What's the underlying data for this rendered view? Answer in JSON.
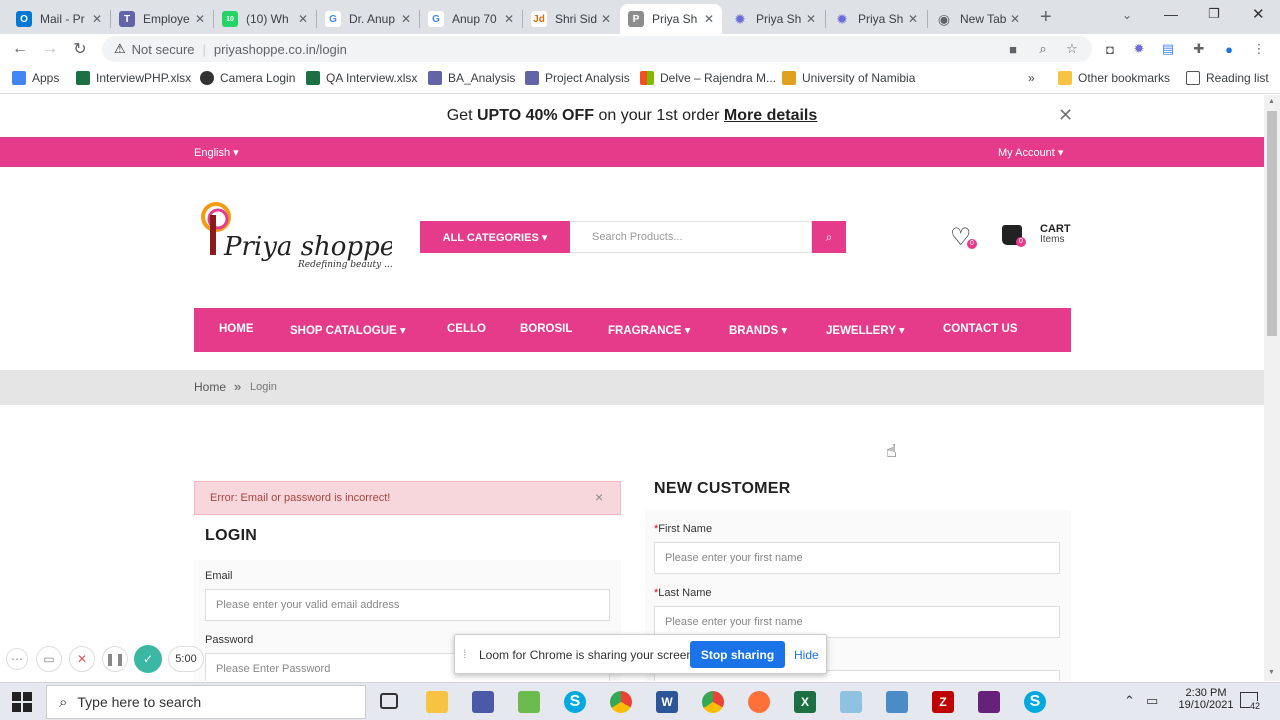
{
  "tabs": [
    {
      "title": "Mail - Pr",
      "fav": "outlook-icon",
      "color": "#0078d4",
      "glyph": "O"
    },
    {
      "title": "Employe",
      "fav": "teams-icon",
      "color": "#6264a7",
      "glyph": "T"
    },
    {
      "title": "(10) Wh",
      "fav": "whatsapp-icon",
      "color": "#25d366",
      "glyph": "10"
    },
    {
      "title": "Dr. Anup",
      "fav": "google-icon",
      "color": "#ffffff",
      "glyph": "G"
    },
    {
      "title": "Anup 70",
      "fav": "google-icon",
      "color": "#ffffff",
      "glyph": "G"
    },
    {
      "title": "Shri Sidd",
      "fav": "justdial-icon",
      "color": "#ffffff",
      "glyph": "Jd"
    },
    {
      "title": "Priya Sh",
      "fav": "priya-icon",
      "color": "#8d8d8d",
      "glyph": "P"
    },
    {
      "title": "Priya Sh",
      "fav": "gear-icon",
      "color": "#6c6cd8",
      "glyph": "✹"
    },
    {
      "title": "Priya Sh",
      "fav": "gear-icon",
      "color": "#6c6cd8",
      "glyph": "✹"
    },
    {
      "title": "New Tab",
      "fav": "chrome-icon",
      "color": "#5f6368",
      "glyph": "◉"
    }
  ],
  "toolbar": {
    "security": "Not secure",
    "url": "priyashoppe.co.in/login"
  },
  "bookmarks": {
    "items": [
      {
        "label": "Apps",
        "color": "#4285f4"
      },
      {
        "label": "InterviewPHP.xlsx",
        "color": "#1d7044"
      },
      {
        "label": "Camera Login",
        "color": "#333333"
      },
      {
        "label": "QA Interview.xlsx",
        "color": "#1d7044"
      },
      {
        "label": "BA_Analysis",
        "color": "#6264a7"
      },
      {
        "label": "Project Analysis",
        "color": "#6264a7"
      },
      {
        "label": "Delve – Rajendra M...",
        "color": "#f25022"
      },
      {
        "label": "University of Namibia",
        "color": "#e0a020"
      }
    ],
    "more": "»",
    "other": "Other bookmarks",
    "reading": "Reading list"
  },
  "promo": {
    "prefix": "Get",
    "bold": "UPTO 40% OFF",
    "middle": "on your 1st order",
    "link": "More details"
  },
  "topbar": {
    "language": "English ▾",
    "account": "My Account ▾"
  },
  "logo": {
    "name": "Priya shoppe",
    "tagline": "Redefining beauty ..."
  },
  "search": {
    "category": "ALL CATEGORIES ▾",
    "placeholder": "Search Products..."
  },
  "cart": {
    "label": "CART",
    "sub": "Items",
    "wish_count": "0",
    "cart_count": "0"
  },
  "nav": [
    "HOME",
    "SHOP CATALOGUE ▾",
    "CELLO",
    "BOROSIL",
    "FRAGRANCE ▾",
    "BRANDS ▾",
    "JEWELLERY ▾",
    "CONTACT US"
  ],
  "breadcrumb": {
    "home": "Home",
    "sep": "»",
    "current": "Login"
  },
  "error": {
    "text": "Error: Email or password is incorrect!",
    "close": "×"
  },
  "login": {
    "title": "LOGIN",
    "email_label": "Email",
    "email_placeholder": "Please enter your valid email address",
    "password_label": "Password",
    "password_placeholder": "Please Enter Password"
  },
  "register": {
    "title": "NEW CUSTOMER",
    "first_label": "First Name",
    "first_placeholder": "Please enter your first name",
    "last_label": "Last Name",
    "last_placeholder": "Please enter your first name",
    "required": "*"
  },
  "loom": {
    "message": "Loom for Chrome is sharing your screen.",
    "stop": "Stop sharing",
    "hide": "Hide",
    "timer": "5:00"
  },
  "taskbar": {
    "search": "Type here to search",
    "time": "2:30 PM",
    "date": "19/10/2021",
    "notifications": "42"
  },
  "colors": {
    "brand": "#e63b8a"
  }
}
